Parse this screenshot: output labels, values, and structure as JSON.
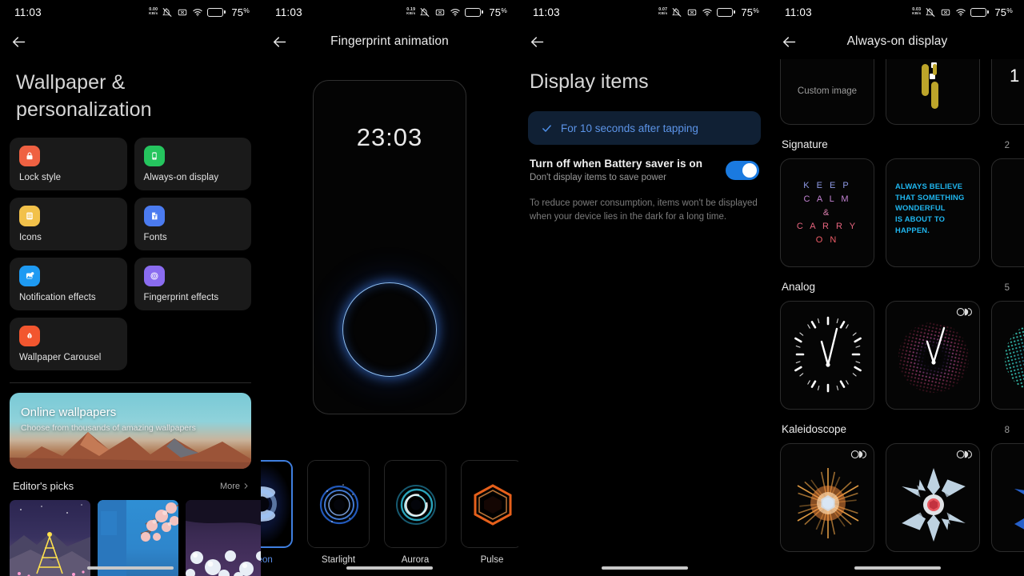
{
  "statusbar": {
    "time": "11:03",
    "speed_value": "0.00",
    "speed_unit": "KB/s",
    "speed_value_2": "0.19",
    "speed_value_3": "0.07",
    "speed_value_4": "0.03",
    "battery_percent": "75",
    "battery_percent_symbol": "%",
    "icons": [
      "network-speed",
      "notifications-muted",
      "dnd-icon",
      "wifi-icon",
      "battery-icon"
    ]
  },
  "panel1": {
    "title": "Wallpaper & personalization",
    "title_line1": "Wallpaper &",
    "title_line2": "personalization",
    "back_label": "Back",
    "tiles": [
      {
        "label": "Lock style",
        "icon": "lock-icon",
        "color": "#ef6142"
      },
      {
        "label": "Always-on display",
        "icon": "phone-icon",
        "color": "#25c55e"
      },
      {
        "label": "Icons",
        "icon": "app-grid-icon",
        "color": "#f2c14a"
      },
      {
        "label": "Fonts",
        "icon": "font-file-icon",
        "color": "#4b7bf0"
      },
      {
        "label": "Notification effects",
        "icon": "notification-icon",
        "color": "#1e9af2"
      },
      {
        "label": "Fingerprint effects",
        "icon": "fingerprint-icon",
        "color": "#8a6cf0"
      },
      {
        "label": "Wallpaper Carousel",
        "icon": "carousel-icon",
        "color": "#f2562f"
      }
    ],
    "promo": {
      "heading": "Online wallpapers",
      "subheading": "Choose from thousands of amazing wallpapers"
    },
    "section": {
      "heading": "Editor's picks",
      "more_label": "More",
      "more_chevron": "chevron-right-icon"
    },
    "thumbnails": [
      {
        "name": "christmas-tree-night-wallpaper"
      },
      {
        "name": "cherry-blossom-blue-wallpaper"
      },
      {
        "name": "purple-diamonds-wallpaper"
      }
    ]
  },
  "panel2": {
    "title": "Fingerprint animation",
    "preview": {
      "clock": "23:03",
      "effect": "glowing-blue-ring"
    },
    "animations": [
      {
        "label": "Neon",
        "selected": true
      },
      {
        "label": "Starlight",
        "selected": false
      },
      {
        "label": "Aurora",
        "selected": false
      },
      {
        "label": "Pulse",
        "selected": false
      }
    ]
  },
  "panel3": {
    "title": "Display items",
    "selected_option": "For 10 seconds after tapping",
    "check_icon": "check-icon",
    "toggle": {
      "title": "Turn off when Battery saver is on",
      "subtitle": "Don't display items to save power",
      "state": "on"
    },
    "footnote": "To reduce power consumption, items won't be displayed when your device lies in the dark for a long time."
  },
  "panel4": {
    "title": "Always-on display",
    "top_row": [
      {
        "label": "Custom image",
        "type": "custom-image"
      },
      {
        "label": "",
        "type": "yellow-digits-clock"
      },
      {
        "label": "",
        "type": "blue-digits-clock"
      }
    ],
    "groups": [
      {
        "name": "Signature",
        "count": "2",
        "items": [
          {
            "type": "signature-keep-calm",
            "lines": [
              "K E E P",
              "C A L M",
              "&",
              "C A R R Y",
              "O N"
            ],
            "badge": false
          },
          {
            "type": "signature-always-believe",
            "text": "ALWAYS BELIEVE THAT SOMETHING WONDERFUL IS ABOUT TO HAPPEN.",
            "lines": [
              "ALWAYS BELIEVE",
              "THAT SOMETHING",
              "WONDERFUL",
              "IS ABOUT TO",
              "HAPPEN."
            ],
            "badge": false
          }
        ]
      },
      {
        "name": "Analog",
        "count": "5",
        "items": [
          {
            "type": "analog-clock-plain",
            "badge": false
          },
          {
            "type": "analog-clock-dots-warm",
            "badge": true
          },
          {
            "type": "analog-clock-dots-teal",
            "badge": false
          }
        ]
      },
      {
        "name": "Kaleidoscope",
        "count": "8",
        "items": [
          {
            "type": "kaleidoscope-orange",
            "badge": true
          },
          {
            "type": "kaleidoscope-snowflake",
            "badge": true
          },
          {
            "type": "kaleidoscope-blue",
            "badge": false
          }
        ]
      }
    ],
    "badge_icon": "paired-circles-icon"
  },
  "colors": {
    "background": "#000000",
    "tile_bg": "#1a1a1a",
    "accent_blue": "#1a7ae0",
    "chip_bg": "#102034",
    "chip_text": "#5c94e8",
    "selected_border": "#3f7fe0"
  }
}
